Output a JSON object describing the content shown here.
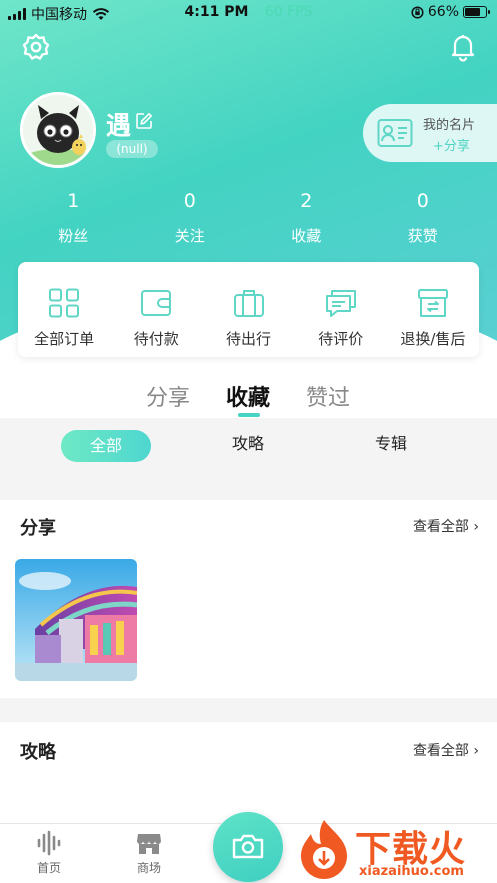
{
  "status_bar": {
    "carrier": "中国移动",
    "time": "4:11 PM",
    "fps": "60 FPS",
    "battery": "66%"
  },
  "profile": {
    "username": "遇",
    "signature": "(null)",
    "card_title": "我的名片",
    "card_share": "+分享"
  },
  "stats": [
    {
      "value": "1",
      "label": "粉丝"
    },
    {
      "value": "0",
      "label": "关注"
    },
    {
      "value": "2",
      "label": "收藏"
    },
    {
      "value": "0",
      "label": "获赞"
    }
  ],
  "orders": [
    {
      "label": "全部订单",
      "icon": "grid-icon"
    },
    {
      "label": "待付款",
      "icon": "wallet-icon"
    },
    {
      "label": "待出行",
      "icon": "suitcase-icon"
    },
    {
      "label": "待评价",
      "icon": "comment-icon"
    },
    {
      "label": "退换/售后",
      "icon": "return-box-icon"
    }
  ],
  "main_tabs": [
    "分享",
    "收藏",
    "赞过"
  ],
  "sub_tabs": [
    "全部",
    "攻略",
    "专辑"
  ],
  "sections": {
    "share": {
      "title": "分享",
      "more": "查看全部"
    },
    "guide": {
      "title": "攻略",
      "more": "查看全部"
    }
  },
  "bottom_nav": {
    "home": "首页",
    "market": "商场"
  },
  "watermark": {
    "main": "下载火",
    "sub": "xiazaihuo.com"
  },
  "colors": {
    "accent": "#47d4c4",
    "header_start": "#6fe6c9",
    "header_end": "#5ccfd5",
    "watermark": "#f05a22"
  }
}
